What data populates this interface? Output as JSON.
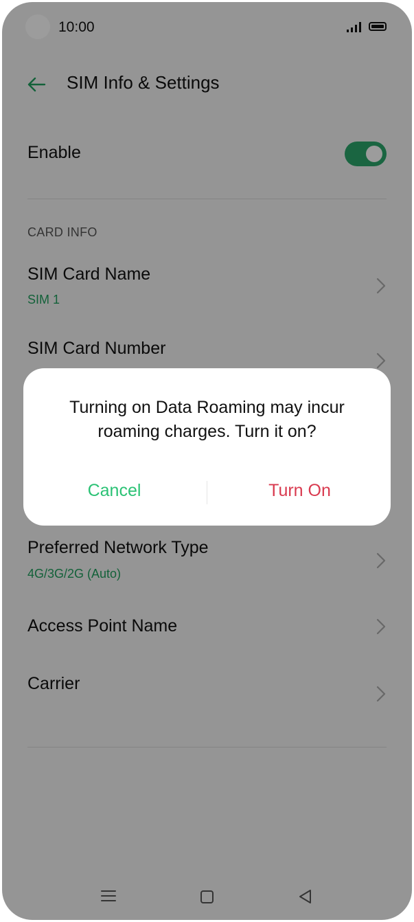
{
  "status_bar": {
    "time": "10:00"
  },
  "header": {
    "title": "SIM Info & Settings"
  },
  "enable": {
    "label": "Enable",
    "on": true
  },
  "card_info": {
    "section_label": "CARD INFO",
    "items": [
      {
        "title": "SIM Card Name",
        "subtitle": "SIM 1"
      },
      {
        "title": "SIM Card Number",
        "subtitle": ""
      },
      {
        "title": "Preferred Network Type",
        "subtitle": "4G/3G/2G (Auto)"
      },
      {
        "title": "Access Point Name",
        "subtitle": ""
      },
      {
        "title": "Carrier",
        "subtitle": ""
      }
    ]
  },
  "dialog": {
    "message_line1": "Turning on Data Roaming may incur",
    "message_line2": "roaming charges. Turn it on?",
    "cancel_label": "Cancel",
    "confirm_label": "Turn On"
  },
  "colors": {
    "accent": "#2ba66b",
    "cancel": "#2bc275",
    "confirm": "#d93a4f"
  }
}
